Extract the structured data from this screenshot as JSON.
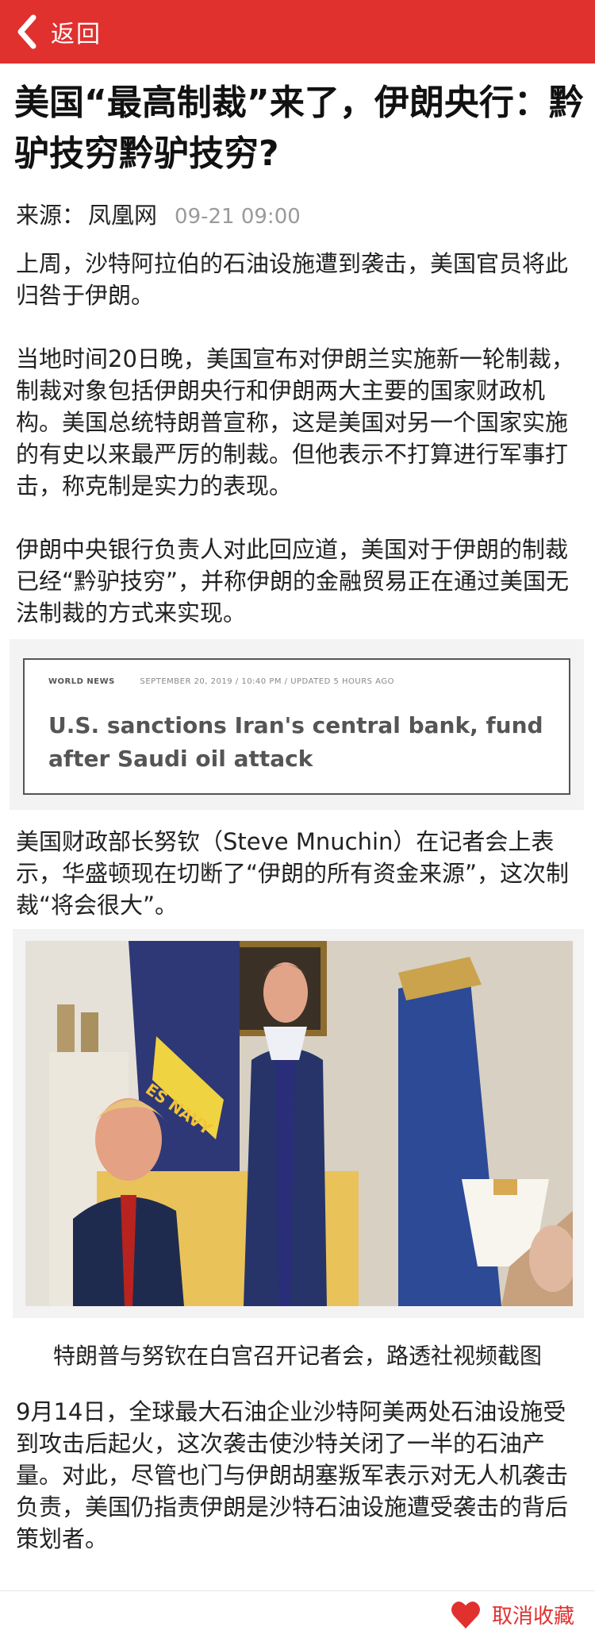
{
  "header": {
    "back_label": "返回"
  },
  "article": {
    "title": "美国“最高制裁”来了，伊朗央行：黔驴技穷黔驴技穷?",
    "source_label": "来源：",
    "source_name": "凤凰网",
    "datetime": "09-21 09:00",
    "paragraphs": [
      "上周，沙特阿拉伯的石油设施遭到袭击，美国官员将此归咎于伊朗。",
      "当地时间20日晚，美国宣布对伊朗兰实施新一轮制裁，制裁对象包括伊朗央行和伊朗两大主要的国家财政机构。美国总统特朗普宣称，这是美国对另一个国家实施的有史以来最严厉的制裁。但他表示不打算进行军事打击，称克制是实力的表现。",
      "伊朗中央银行负责人对此回应道，美国对于伊朗的制裁已经“黔驴技穷”，并称伊朗的金融贸易正在通过美国无法制裁的方式来实现。",
      "美国财政部长努钦（Steve Mnuchin）在记者会上表示，华盛顿现在切断了“伊朗的所有资金来源”，这次制裁“将会很大”。",
      "9月14日，全球最大石油企业沙特阿美两处石油设施受到攻击后起火，这次袭击使沙特关闭了一半的石油产量。对此，尽管也门与伊朗胡塞叛军表示对无人机袭击负责，美国仍指责伊朗是沙特石油设施遭受袭击的背后策划者。"
    ],
    "news_card": {
      "tag": "WORLD NEWS",
      "meta": "SEPTEMBER 20, 2019 / 10:40 PM / UPDATED 5 HOURS AGO",
      "headline": "U.S. sanctions Iran's central bank, fund after Saudi oil attack"
    },
    "photo": {
      "flag_text": "ES NAVY"
    },
    "photo_caption": "特朗普与努钦在白宫召开记者会，路透社视频截图"
  },
  "footer": {
    "unfavorite_label": "取消收藏",
    "accent": "#e0312f"
  },
  "icons": {
    "back": "chevron-left-icon",
    "favorite": "heart-icon"
  }
}
